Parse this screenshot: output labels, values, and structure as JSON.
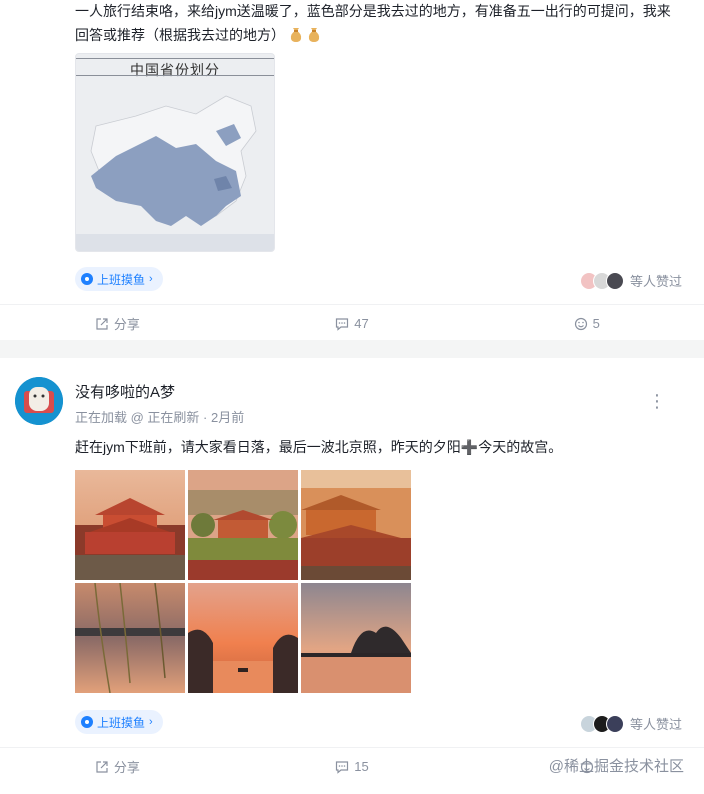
{
  "post1": {
    "text_line1": "一人旅行结束咯，来给jym送温暖了，蓝色部分是我去过的地方，有准备五一出行的可提问，我来",
    "text_line2": "回答或推荐（根据我去过的地方）",
    "map_title": "中国省份划分",
    "tag_label": "上班摸鱼",
    "likers_text": "等人赞过",
    "share_label": "分享",
    "comment_count": "47",
    "like_count": "5"
  },
  "post2": {
    "username": "没有哆啦的A梦",
    "meta": "正在加载 @ 正在刷新 · 2月前",
    "text": "赶在jym下班前，请大家看日落，最后一波北京照，昨天的夕阳➕今天的故宫。",
    "tag_label": "上班摸鱼",
    "likers_text": "等人赞过",
    "share_label": "分享",
    "comment_count": "15",
    "watermark": "@稀土掘金技术社区"
  },
  "colors": {
    "accent": "#1e80ff",
    "muted": "#8a919f",
    "map_region": "#8c9fc0"
  },
  "icons": {
    "share": "share-icon",
    "comment": "comment-icon",
    "like": "thumbs-up-icon",
    "more": "more-vertical-icon",
    "tag": "topic-icon"
  }
}
